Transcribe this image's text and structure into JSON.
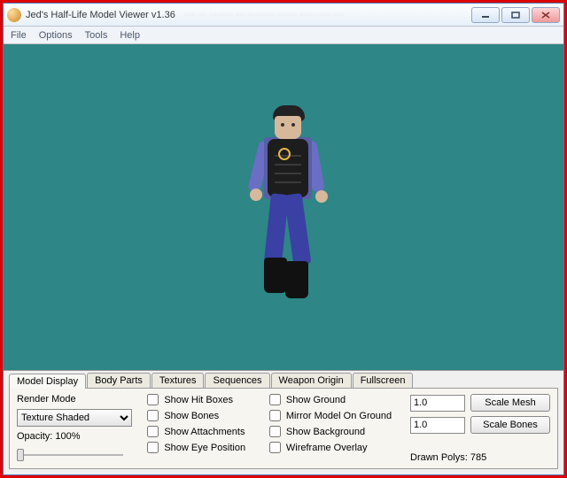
{
  "window": {
    "title": "Jed's Half-Life Model Viewer v1.36",
    "blur_text": "··· ·· ······ ·· ······· ····· ········ ···"
  },
  "menu": {
    "file": "File",
    "options": "Options",
    "tools": "Tools",
    "help": "Help"
  },
  "tabs": {
    "model_display": "Model Display",
    "body_parts": "Body Parts",
    "textures": "Textures",
    "sequences": "Sequences",
    "weapon_origin": "Weapon Origin",
    "fullscreen": "Fullscreen"
  },
  "render": {
    "mode_label": "Render Mode",
    "mode_value": "Texture Shaded",
    "opacity_label": "Opacity: 100%"
  },
  "checks": {
    "hit_boxes": "Show Hit Boxes",
    "bones": "Show Bones",
    "attachments": "Show Attachments",
    "eye_position": "Show Eye Position",
    "ground": "Show Ground",
    "mirror": "Mirror Model On Ground",
    "background": "Show Background",
    "wireframe": "Wireframe Overlay"
  },
  "scale": {
    "mesh_value": "1.0",
    "mesh_btn": "Scale Mesh",
    "bones_value": "1.0",
    "bones_btn": "Scale Bones"
  },
  "status": {
    "drawn_polys": "Drawn Polys: 785"
  },
  "colors": {
    "viewport_bg": "#2e8686"
  }
}
